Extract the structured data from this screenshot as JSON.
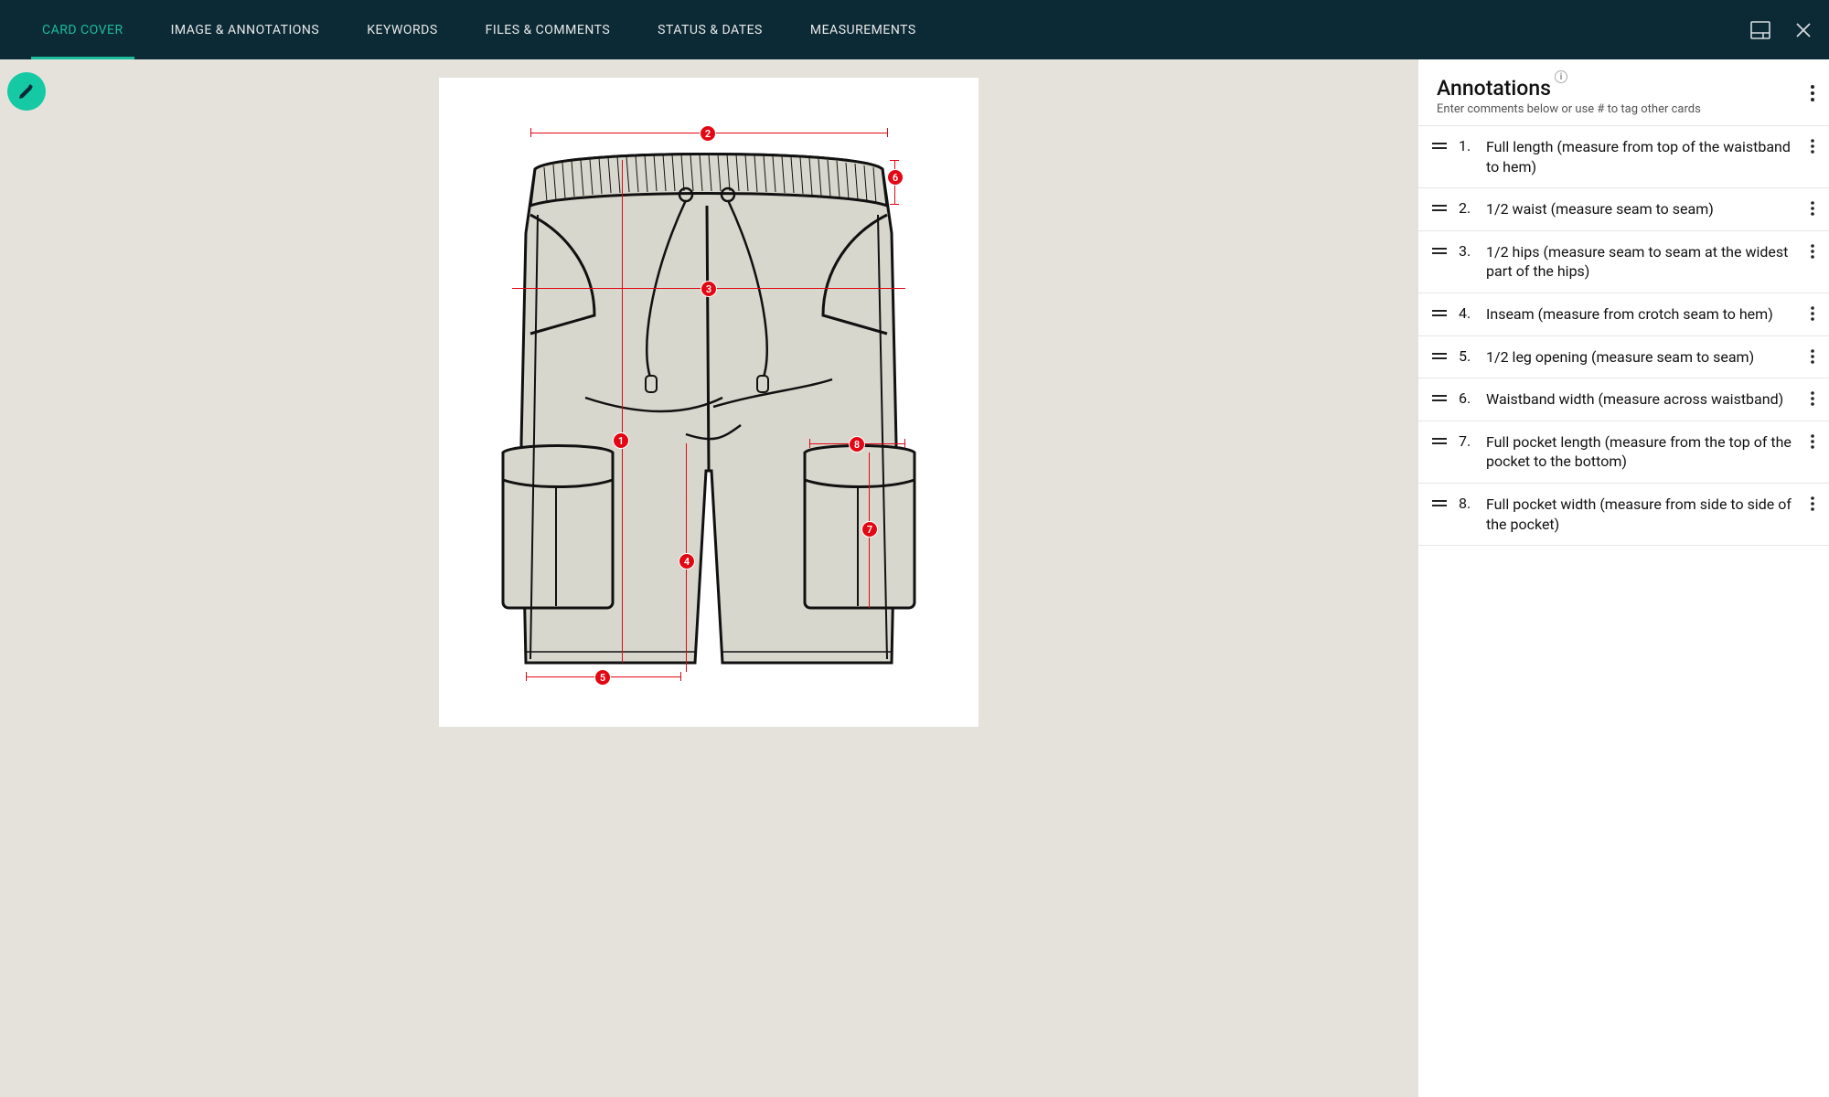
{
  "header": {
    "tabs": [
      {
        "label": "CARD COVER",
        "active": true
      },
      {
        "label": "IMAGE & ANNOTATIONS",
        "active": false
      },
      {
        "label": "KEYWORDS",
        "active": false
      },
      {
        "label": "FILES & COMMENTS",
        "active": false
      },
      {
        "label": "STATUS & DATES",
        "active": false
      },
      {
        "label": "MEASUREMENTS",
        "active": false
      }
    ]
  },
  "sidebar": {
    "title": "Annotations",
    "subtitle": "Enter comments below or use # to tag other cards",
    "items": [
      {
        "num": "1.",
        "text": "Full length (measure from top of the waistband to hem)"
      },
      {
        "num": "2.",
        "text": "1/2 waist (measure seam to seam)"
      },
      {
        "num": "3.",
        "text": "1/2 hips (measure seam to seam at the widest part of the hips)"
      },
      {
        "num": "4.",
        "text": "Inseam (measure from crotch seam to hem)"
      },
      {
        "num": "5.",
        "text": "1/2 leg opening (measure seam to seam)"
      },
      {
        "num": "6.",
        "text": "Waistband width (measure across waistband)"
      },
      {
        "num": "7.",
        "text": "Full pocket length (measure from the top of the pocket to the bottom)"
      },
      {
        "num": "8.",
        "text": "Full pocket width (measure from side to side of the pocket)"
      }
    ]
  },
  "markers": {
    "m1": "1",
    "m2": "2",
    "m3": "3",
    "m4": "4",
    "m5": "5",
    "m6": "6",
    "m7": "7",
    "m8": "8"
  }
}
